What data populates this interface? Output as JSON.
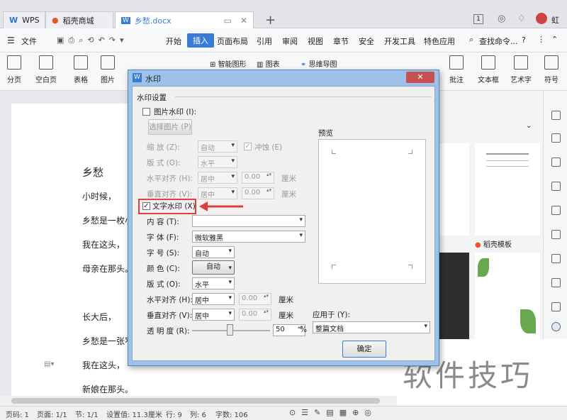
{
  "tabs": [
    {
      "label": "WPS"
    },
    {
      "label": "稻壳商城"
    },
    {
      "label": "乡愁.docx"
    }
  ],
  "titlebar": {
    "badge": "1",
    "user": "虹"
  },
  "menu": {
    "file": "文件",
    "items": [
      "开始",
      "插入",
      "页面布局",
      "引用",
      "审阅",
      "视图",
      "章节",
      "安全",
      "开发工具",
      "特色应用"
    ],
    "search": "查找命令...",
    "help": "?"
  },
  "ribbon": [
    "分页",
    "空白页",
    "表格",
    "图片",
    "智能图形",
    "图表",
    "思维导图",
    "批注",
    "文本框",
    "艺术字",
    "符号"
  ],
  "doc": {
    "title": "乡愁",
    "lines": [
      "小时候，",
      "乡愁是一枚小",
      "我在这头，",
      "母亲在那头。",
      "长大后，",
      "乡愁是一张窄",
      "我在这头，",
      "新娘在那头。"
    ]
  },
  "right_panel": {
    "label": "稻壳模板"
  },
  "dialog": {
    "title": "水印",
    "section": "水印设置",
    "picture_watermark": "图片水印 (I):",
    "select_picture": "选择图片 (P)",
    "scale_label": "缩   放 (Z):",
    "scale_value": "自动",
    "washout": "冲蚀 (E)",
    "layout_label": "版   式 (O):",
    "layout_value": "水平",
    "halign_label": "水平对齐 (H):",
    "halign_value": "居中",
    "valign_label": "垂直对齐 (V):",
    "valign_value": "居中",
    "offset_value": "0.00",
    "unit": "厘米",
    "text_watermark": "文字水印 (X)",
    "content_label": "内   容 (T):",
    "content_value": "",
    "font_label": "字   体 (F):",
    "font_value": "微软雅黑",
    "size_label": "字   号 (S):",
    "size_value": "自动",
    "color_label": "颜   色 (C):",
    "color_value": "自动",
    "t_layout_label": "版   式 (O):",
    "t_layout_value": "水平",
    "t_halign_label": "水平对齐 (H):",
    "t_halign_value": "居中",
    "t_valign_label": "垂直对齐 (V):",
    "t_valign_value": "居中",
    "transparency_label": "透 明 度 (R):",
    "transparency_value": "50",
    "percent": "%",
    "preview": "预览",
    "apply_label": "应用于 (Y):",
    "apply_value": "整篇文档",
    "ok": "确定"
  },
  "status": {
    "page_num": "页码: 1",
    "pages": "页面: 1/1",
    "section": "节: 1/1",
    "setting": "设置值: 11.3厘米",
    "row": "行: 9",
    "col": "列: 6",
    "words": "字数: 106"
  },
  "watermark_text": "软件技巧",
  "colors": {
    "accent": "#3a7bd5",
    "highlight_box": "#e0403a",
    "dialog_frame": "#9cc2e9"
  }
}
